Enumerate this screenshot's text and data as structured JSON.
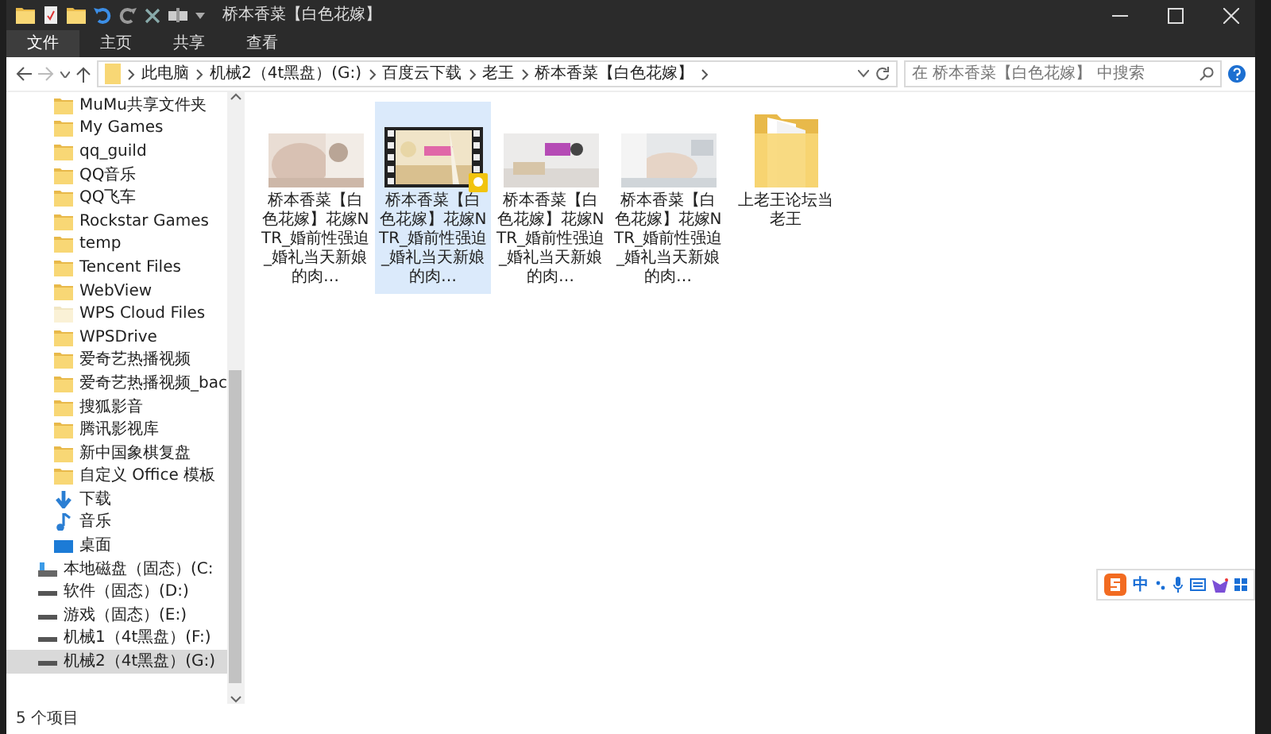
{
  "window": {
    "title": "桥本香菜【白色花嫁】"
  },
  "ribbon_tabs": [
    {
      "label": "文件",
      "selected": true
    },
    {
      "label": "主页",
      "selected": false
    },
    {
      "label": "共享",
      "selected": false
    },
    {
      "label": "查看",
      "selected": false
    }
  ],
  "breadcrumb": [
    "此电脑",
    "机械2（4t黑盘）(G:)",
    "百度云下载",
    "老王",
    "桥本香菜【白色花嫁】"
  ],
  "search": {
    "placeholder": "在 桥本香菜【白色花嫁】 中搜索"
  },
  "sidebar": {
    "items": [
      {
        "kind": "folder",
        "label": "MuMu共享文件夹",
        "selected": false
      },
      {
        "kind": "folder",
        "label": "My Games",
        "selected": false
      },
      {
        "kind": "folder",
        "label": "qq_guild",
        "selected": false
      },
      {
        "kind": "folder",
        "label": "QQ音乐",
        "selected": false
      },
      {
        "kind": "folder",
        "label": "QQ飞车",
        "selected": false
      },
      {
        "kind": "folder",
        "label": "Rockstar Games",
        "selected": false
      },
      {
        "kind": "folder",
        "label": "temp",
        "selected": false
      },
      {
        "kind": "folder",
        "label": "Tencent Files",
        "selected": false
      },
      {
        "kind": "folder",
        "label": "WebView",
        "selected": false
      },
      {
        "kind": "cloud-folder",
        "label": "WPS Cloud Files",
        "selected": false
      },
      {
        "kind": "folder",
        "label": "WPSDrive",
        "selected": false
      },
      {
        "kind": "folder",
        "label": "爱奇艺热播视频",
        "selected": false
      },
      {
        "kind": "folder",
        "label": "爱奇艺热播视频_bac",
        "selected": false
      },
      {
        "kind": "folder",
        "label": "搜狐影音",
        "selected": false
      },
      {
        "kind": "folder",
        "label": "腾讯影视库",
        "selected": false
      },
      {
        "kind": "folder",
        "label": "新中国象棋复盘",
        "selected": false
      },
      {
        "kind": "folder",
        "label": "自定义 Office 模板",
        "selected": false
      },
      {
        "kind": "download",
        "label": "下载",
        "selected": false
      },
      {
        "kind": "music",
        "label": "音乐",
        "selected": false
      },
      {
        "kind": "desktop",
        "label": "桌面",
        "selected": false
      },
      {
        "kind": "system-drive",
        "label": "本地磁盘（固态）(C:",
        "selected": false
      },
      {
        "kind": "drive",
        "label": "软件（固态）(D:)",
        "selected": false
      },
      {
        "kind": "drive",
        "label": "游戏（固态）(E:)",
        "selected": false
      },
      {
        "kind": "drive",
        "label": "机械1（4t黑盘）(F:)",
        "selected": false
      },
      {
        "kind": "drive",
        "label": "机械2（4t黑盘）(G:)",
        "selected": true
      }
    ]
  },
  "files": [
    {
      "kind": "video",
      "name": "桥本香菜【白色花嫁】花嫁NTR_婚前性强迫_婚礼当天新娘的肉…",
      "selected": false,
      "film_frame": false
    },
    {
      "kind": "video",
      "name": "桥本香菜【白色花嫁】花嫁NTR_婚前性强迫_婚礼当天新娘的肉…",
      "selected": true,
      "film_frame": true
    },
    {
      "kind": "video",
      "name": "桥本香菜【白色花嫁】花嫁NTR_婚前性强迫_婚礼当天新娘的肉…",
      "selected": false,
      "film_frame": false
    },
    {
      "kind": "video",
      "name": "桥本香菜【白色花嫁】花嫁NTR_婚前性强迫_婚礼当天新娘的肉…",
      "selected": false,
      "film_frame": false
    },
    {
      "kind": "folder",
      "name": "上老王论坛当老王",
      "selected": false
    }
  ],
  "status_bar": {
    "count": "5 个项目"
  },
  "ime_toolbar": {
    "mode": "中"
  }
}
